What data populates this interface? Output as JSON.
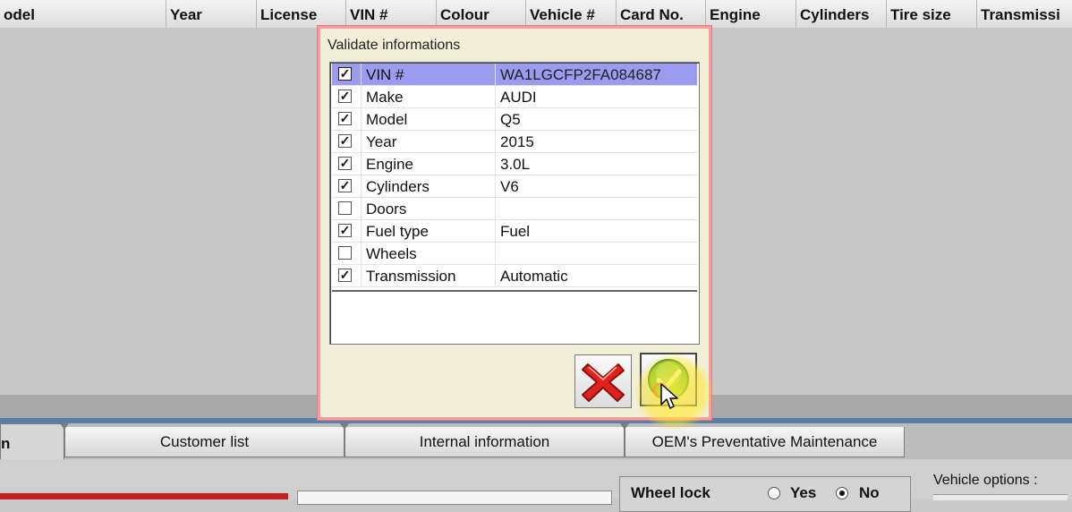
{
  "grid": {
    "columns": [
      "odel",
      "Year",
      "License",
      "VIN #",
      "Colour",
      "Vehicle #",
      "Card No.",
      "Engine",
      "Cylinders",
      "Tire size",
      "Transmissi"
    ]
  },
  "dialog": {
    "title": "Validate informations",
    "rows": [
      {
        "label": "VIN #",
        "value": "WA1LGCFP2FA084687",
        "checked": true,
        "selected": true
      },
      {
        "label": "Make",
        "value": "AUDI",
        "checked": true
      },
      {
        "label": "Model",
        "value": "Q5",
        "checked": true
      },
      {
        "label": "Year",
        "value": "2015",
        "checked": true
      },
      {
        "label": "Engine",
        "value": "3.0L",
        "checked": true
      },
      {
        "label": "Cylinders",
        "value": "V6",
        "checked": true
      },
      {
        "label": "Doors",
        "value": "",
        "checked": false
      },
      {
        "label": "Fuel type",
        "value": "Fuel",
        "checked": true
      },
      {
        "label": "Wheels",
        "value": "",
        "checked": false
      },
      {
        "label": "Transmission",
        "value": "Automatic",
        "checked": true
      }
    ],
    "cancel_icon": "red-x-icon",
    "ok_icon": "green-check-icon"
  },
  "tabs": {
    "active_fragment": "n",
    "items": [
      "Customer list",
      "Internal information",
      "OEM's Preventative Maintenance"
    ]
  },
  "lower": {
    "wheel_lock_label": "Wheel lock",
    "yes_label": "Yes",
    "no_label": "No",
    "selected_option": "No",
    "vehicle_options_label": "Vehicle options :"
  },
  "colors": {
    "selection": "#9b9bef",
    "dialog_border": "#f0a0a0",
    "accent_bar": "#5a7ea6",
    "red_bar": "#c5201f"
  }
}
